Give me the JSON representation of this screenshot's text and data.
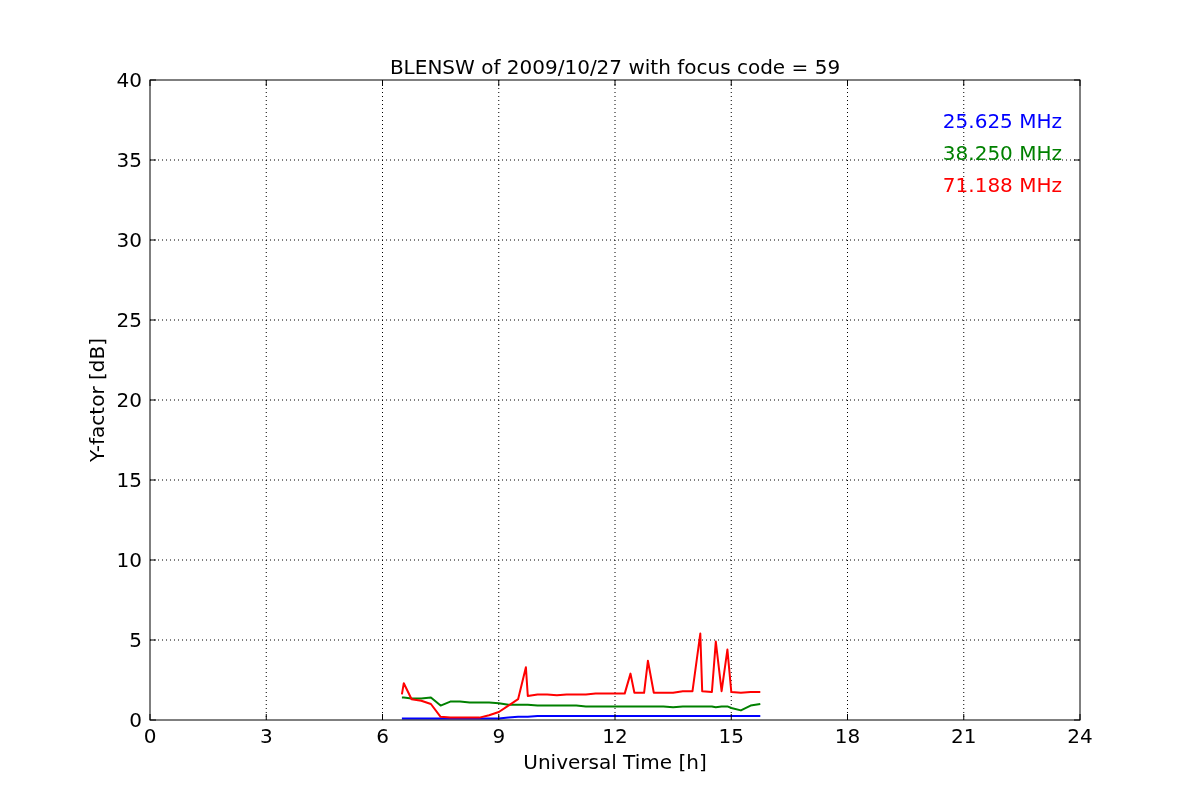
{
  "chart_data": {
    "type": "line",
    "title": "BLENSW of 2009/10/27 with focus code = 59",
    "xlabel": "Universal Time [h]",
    "ylabel": "Y-factor [dB]",
    "x": [
      6.5,
      6.55,
      6.75,
      7,
      7.25,
      7.5,
      7.75,
      8,
      8.25,
      8.5,
      8.75,
      9,
      9.25,
      9.5,
      9.7,
      9.75,
      10,
      10.25,
      10.5,
      10.75,
      11,
      11.25,
      11.5,
      11.75,
      12,
      12.25,
      12.4,
      12.5,
      12.75,
      12.85,
      13,
      13.25,
      13.5,
      13.75,
      14,
      14.2,
      14.25,
      14.5,
      14.6,
      14.75,
      14.9,
      15,
      15.25,
      15.5,
      15.75
    ],
    "series": [
      {
        "name": "25.625 MHz",
        "color": "#0000ff",
        "values": [
          0.1,
          0.1,
          0.1,
          0.1,
          0.1,
          0.1,
          0.1,
          0.1,
          0.1,
          0.1,
          0.1,
          0.1,
          0.15,
          0.2,
          0.2,
          0.2,
          0.25,
          0.25,
          0.25,
          0.25,
          0.25,
          0.25,
          0.25,
          0.25,
          0.25,
          0.25,
          0.25,
          0.25,
          0.25,
          0.25,
          0.25,
          0.25,
          0.25,
          0.25,
          0.25,
          0.25,
          0.25,
          0.25,
          0.25,
          0.25,
          0.25,
          0.25,
          0.25,
          0.25,
          0.25
        ]
      },
      {
        "name": "38.250 MHz",
        "color": "#008000",
        "values": [
          1.4,
          1.4,
          1.35,
          1.35,
          1.4,
          0.9,
          1.15,
          1.15,
          1.1,
          1.1,
          1.1,
          1.05,
          0.95,
          0.95,
          0.95,
          0.95,
          0.9,
          0.9,
          0.9,
          0.9,
          0.9,
          0.85,
          0.85,
          0.85,
          0.85,
          0.85,
          0.85,
          0.85,
          0.85,
          0.85,
          0.85,
          0.85,
          0.8,
          0.85,
          0.85,
          0.85,
          0.85,
          0.85,
          0.8,
          0.85,
          0.85,
          0.75,
          0.6,
          0.9,
          1.0
        ]
      },
      {
        "name": "71.188 MHz",
        "color": "#ff0000",
        "values": [
          1.6,
          2.3,
          1.3,
          1.2,
          1.0,
          0.2,
          0.15,
          0.15,
          0.15,
          0.15,
          0.3,
          0.5,
          0.9,
          1.3,
          3.3,
          1.5,
          1.6,
          1.6,
          1.55,
          1.6,
          1.6,
          1.6,
          1.65,
          1.65,
          1.65,
          1.65,
          2.9,
          1.7,
          1.7,
          3.7,
          1.7,
          1.7,
          1.7,
          1.8,
          1.8,
          5.4,
          1.8,
          1.75,
          4.9,
          1.8,
          4.4,
          1.75,
          1.7,
          1.75,
          1.75
        ]
      }
    ],
    "xlim": [
      0,
      24
    ],
    "ylim": [
      0,
      40
    ],
    "xticks": [
      0,
      3,
      6,
      9,
      12,
      15,
      18,
      21,
      24
    ],
    "yticks": [
      0,
      5,
      10,
      15,
      20,
      25,
      30,
      35,
      40
    ],
    "grid": true
  }
}
